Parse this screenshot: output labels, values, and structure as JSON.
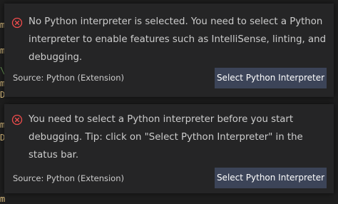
{
  "theme": {
    "toast_bg": "#252526",
    "editor_bg": "#1e1e1e",
    "text": "#cccccc",
    "error_icon": "#f14c4c",
    "button_bg": "#3c4458",
    "button_text": "#ffffff"
  },
  "notifications": [
    {
      "icon": "error-icon",
      "message": "No Python interpreter is selected. You need to select a Python interpreter to enable features such as IntelliSense, linting, and debugging.",
      "source": "Source: Python (Extension)",
      "action_label": "Select Python Interpreter"
    },
    {
      "icon": "error-icon",
      "message": "You need to select a Python interpreter before you start debugging. Tip: click on \"Select Python Interpreter\" in the status bar.",
      "source": "Source: Python (Extension)",
      "action_label": "Select Python Interpreter"
    }
  ]
}
